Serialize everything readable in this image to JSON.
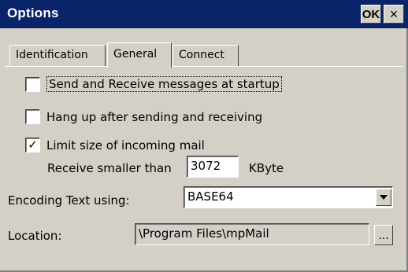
{
  "window": {
    "title": "Options",
    "ok_label": "OK",
    "close_label": "×"
  },
  "tabs": [
    {
      "label": "Identification",
      "selected": false
    },
    {
      "label": "General",
      "selected": true
    },
    {
      "label": "Connect",
      "selected": false
    }
  ],
  "general": {
    "send_receive_startup": {
      "label": "Send and Receive messages at startup",
      "checked": false
    },
    "hang_up": {
      "label": "Hang up after sending and receiving",
      "checked": false
    },
    "limit_size": {
      "label": "Limit size of incoming mail",
      "checked": true,
      "check_glyph": "✓"
    },
    "receive_smaller_label": "Receive smaller than",
    "receive_smaller_value": "3072",
    "size_unit": "KByte",
    "encoding_label": "Encoding Text using:",
    "encoding_value": "BASE64",
    "location_label": "Location:",
    "location_value": "\\Program Files\\mpMail",
    "browse_label": "..."
  }
}
